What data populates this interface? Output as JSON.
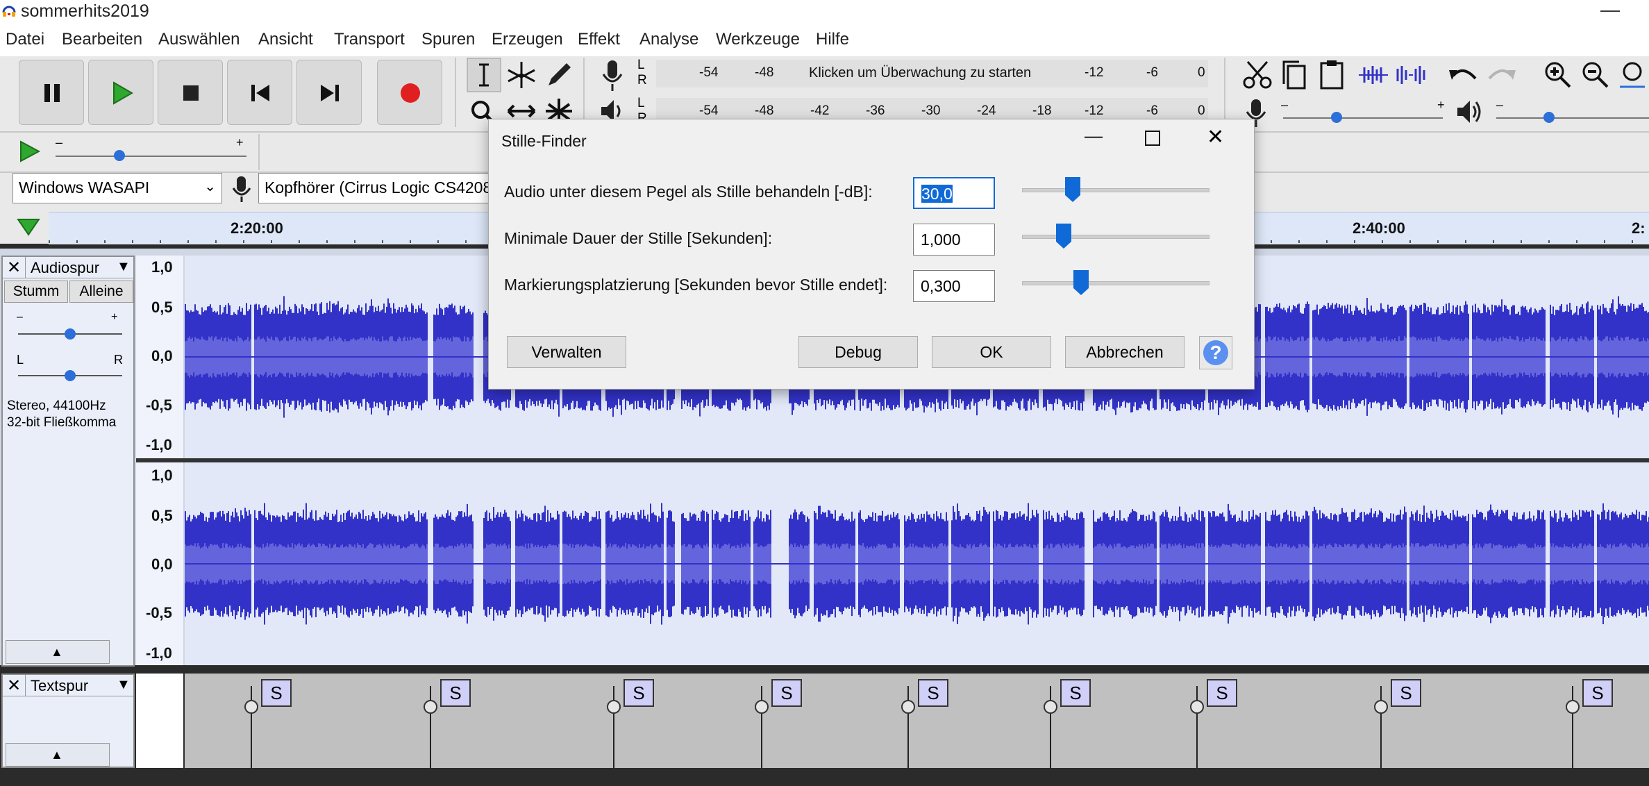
{
  "window": {
    "title": "sommerhits2019"
  },
  "menu": {
    "items": [
      "Datei",
      "Bearbeiten",
      "Auswählen",
      "Ansicht",
      "Transport",
      "Spuren",
      "Erzeugen",
      "Effekt",
      "Analyse",
      "Werkzeuge",
      "Hilfe"
    ]
  },
  "meters": {
    "record_scale": [
      "-54",
      "-48",
      "-12",
      "-6",
      "0"
    ],
    "record_hint": "Klicken um Überwachung zu starten",
    "play_scale": [
      "-54",
      "-48",
      "-42",
      "-36",
      "-30",
      "-24",
      "-18",
      "-12",
      "-6",
      "0"
    ],
    "lr": [
      "L",
      "R"
    ]
  },
  "slider_signs": {
    "minus": "–",
    "plus": "+"
  },
  "devices": {
    "host": "Windows WASAPI",
    "input": "Kopfhörer (Cirrus Logic CS4208"
  },
  "timeline": {
    "labels": [
      "2:20:00",
      "2:40:00",
      "2:"
    ]
  },
  "audio_track": {
    "name": "Audiospur",
    "mute_label": "Stumm",
    "solo_label": "Alleine",
    "pan_left": "L",
    "pan_right": "R",
    "info_line1": "Stereo, 44100Hz",
    "info_line2": "32-bit Fließkomma",
    "scale": [
      "1,0",
      "0,5",
      "0,0",
      "-0,5",
      "-1,0"
    ]
  },
  "label_track": {
    "name": "Textspur",
    "label_text": "S"
  },
  "dialog": {
    "title": "Stille-Finder",
    "threshold_label": "Audio unter diesem Pegel als Stille behandeln [-dB]:",
    "threshold_value": "30,0",
    "min_duration_label": "Minimale Dauer der Stille [Sekunden]:",
    "min_duration_value": "1,000",
    "placement_label": "Markierungsplatzierung [Sekunden bevor Stille endet]:",
    "placement_value": "0,300",
    "manage_label": "Verwalten",
    "debug_label": "Debug",
    "ok_label": "OK",
    "cancel_label": "Abbrechen",
    "help_glyph": "?"
  },
  "colors": {
    "waveform": "#3232c8",
    "waveform_rms": "#6464dc",
    "track_bg": "#e2e8f7",
    "label_bg": "#c0c0c0",
    "accent": "#0f6ad8"
  }
}
